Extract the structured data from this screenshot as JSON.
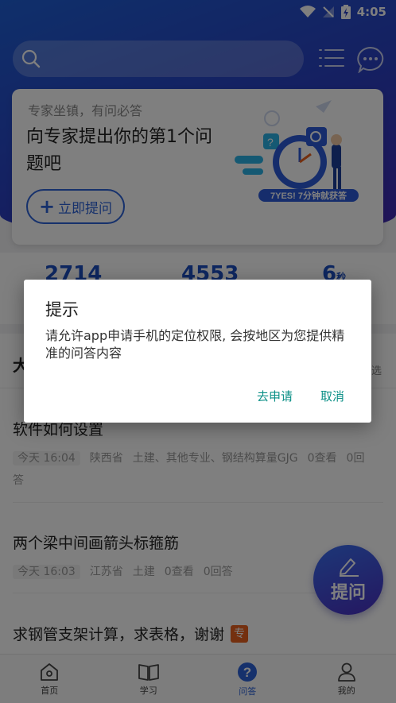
{
  "status_bar": {
    "time": "4:05"
  },
  "card": {
    "subtitle": "专家坐镇，有问必答",
    "title": "向专家提出你的第1个问题吧",
    "ask_button": "立即提问",
    "illustration_caption": "7YES! 7分钟就获答"
  },
  "stats": [
    {
      "value": "2714"
    },
    {
      "value": "4553"
    },
    {
      "value": "6",
      "unit": "秒"
    }
  ],
  "section": {
    "title": "大",
    "filter": "选"
  },
  "questions": [
    {
      "title": "软件如何设置",
      "time": "今天 16:04",
      "region": "陕西省",
      "category": "土建、其他专业、钢结构算量GJG",
      "views": "0查看",
      "answers": "0回答"
    },
    {
      "title": "两个梁中间画箭头标箍筋",
      "time": "今天 16:03",
      "region": "江苏省",
      "category": "土建",
      "views": "0查看",
      "answers": "0回答"
    },
    {
      "title": "求钢管支架计算，求表格，谢谢",
      "badge": "专"
    }
  ],
  "fab": {
    "label": "提问"
  },
  "bottom_nav": [
    {
      "label": "首页",
      "icon": "home-icon"
    },
    {
      "label": "学习",
      "icon": "book-icon"
    },
    {
      "label": "问答",
      "icon": "question-icon",
      "active": true
    },
    {
      "label": "我的",
      "icon": "user-icon"
    }
  ],
  "dialog": {
    "title": "提示",
    "message": "请允许app申请手机的定位权限, 会按地区为您提供精准的问答内容",
    "confirm": "去申请",
    "cancel": "取消"
  },
  "colors": {
    "primary": "#2c62d8",
    "dialog_button": "#0a8f86",
    "badge": "#e8601e"
  }
}
